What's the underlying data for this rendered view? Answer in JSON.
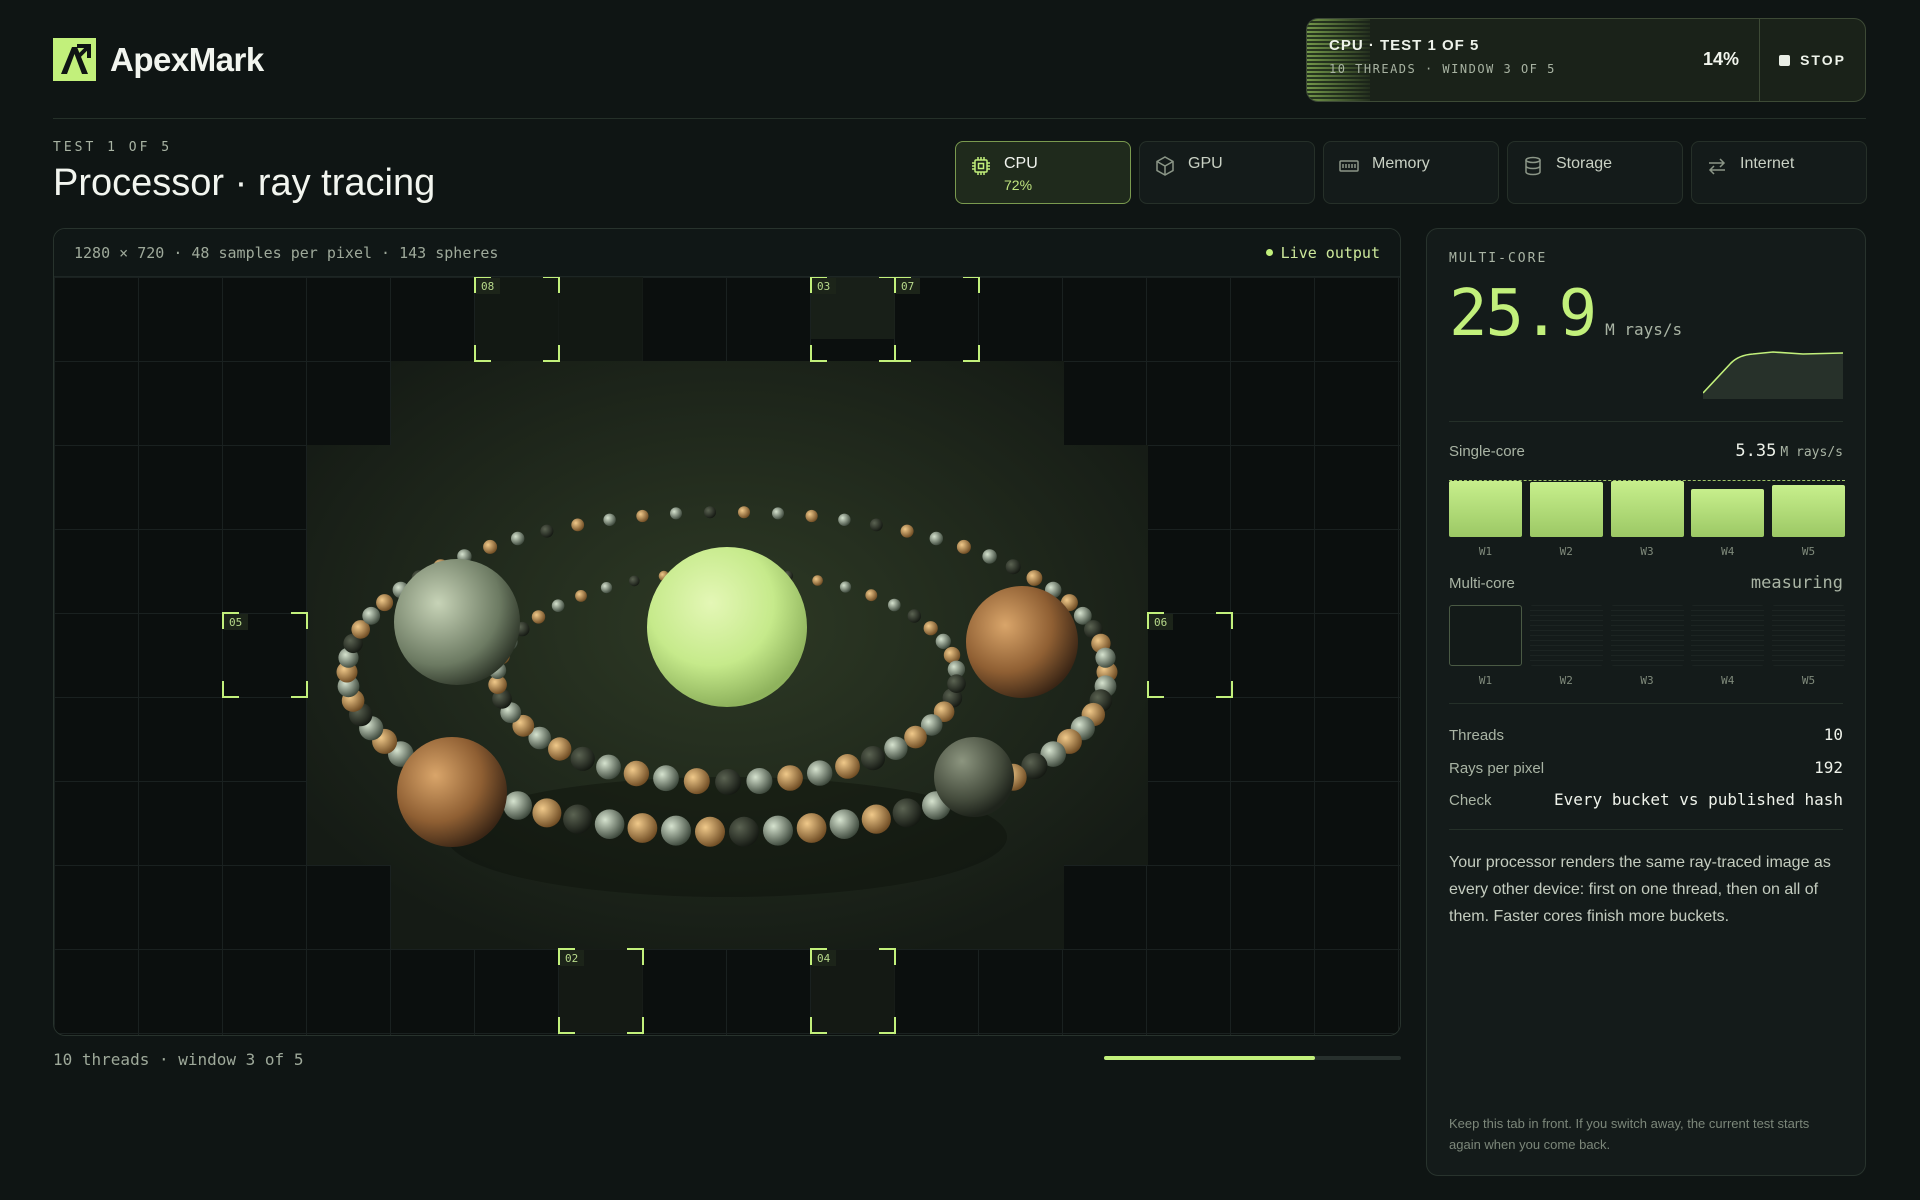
{
  "app": {
    "name": "ApexMark"
  },
  "status": {
    "title": "CPU · TEST 1 OF 5",
    "subtitle": "10 THREADS · WINDOW 3 OF 5",
    "percent": "14%",
    "progress_fraction": 0.14,
    "stop_label": "STOP"
  },
  "page": {
    "test_label": "TEST 1 OF 5",
    "title": "Processor · ray tracing"
  },
  "tabs": [
    {
      "label": "CPU",
      "sub": "72%",
      "icon": "chip-icon",
      "active": true
    },
    {
      "label": "GPU",
      "sub": "",
      "icon": "cube-icon",
      "active": false
    },
    {
      "label": "Memory",
      "sub": "",
      "icon": "ram-icon",
      "active": false
    },
    {
      "label": "Storage",
      "sub": "",
      "icon": "database-icon",
      "active": false
    },
    {
      "label": "Internet",
      "sub": "",
      "icon": "arrows-icon",
      "active": false
    }
  ],
  "render": {
    "meta": "1280 × 720 · 48 samples per pixel · 143 spheres",
    "live_label": "Live output",
    "buckets": [
      "08",
      "03",
      "07",
      "05",
      "06",
      "02",
      "04"
    ],
    "footer": "10 threads · window 3 of 5",
    "progress_fraction": 0.71
  },
  "results": {
    "multi_label": "MULTI-CORE",
    "multi_value": "25.9",
    "multi_unit": "M rays/s",
    "single_label": "Single-core",
    "single_value": "5.35",
    "single_unit": "M rays/s",
    "windows": [
      "W1",
      "W2",
      "W3",
      "W4",
      "W5"
    ],
    "single_fractions": [
      1.0,
      0.98,
      1.0,
      0.85,
      0.93
    ],
    "multi_core_label": "Multi-core",
    "multi_core_status": "measuring",
    "stats": [
      {
        "label": "Threads",
        "value": "10"
      },
      {
        "label": "Rays per pixel",
        "value": "192"
      },
      {
        "label": "Check",
        "value": "Every bucket vs published hash"
      }
    ],
    "description": "Your processor renders the same ray-traced image as every other device: first on one thread, then on all of them. Faster cores finish more buckets.",
    "footnote": "Keep this tab in front. If you switch away, the current test starts again when you come back."
  },
  "colors": {
    "accent": "#c2f07b",
    "background": "#0f1514",
    "panel": "#141b1a"
  }
}
